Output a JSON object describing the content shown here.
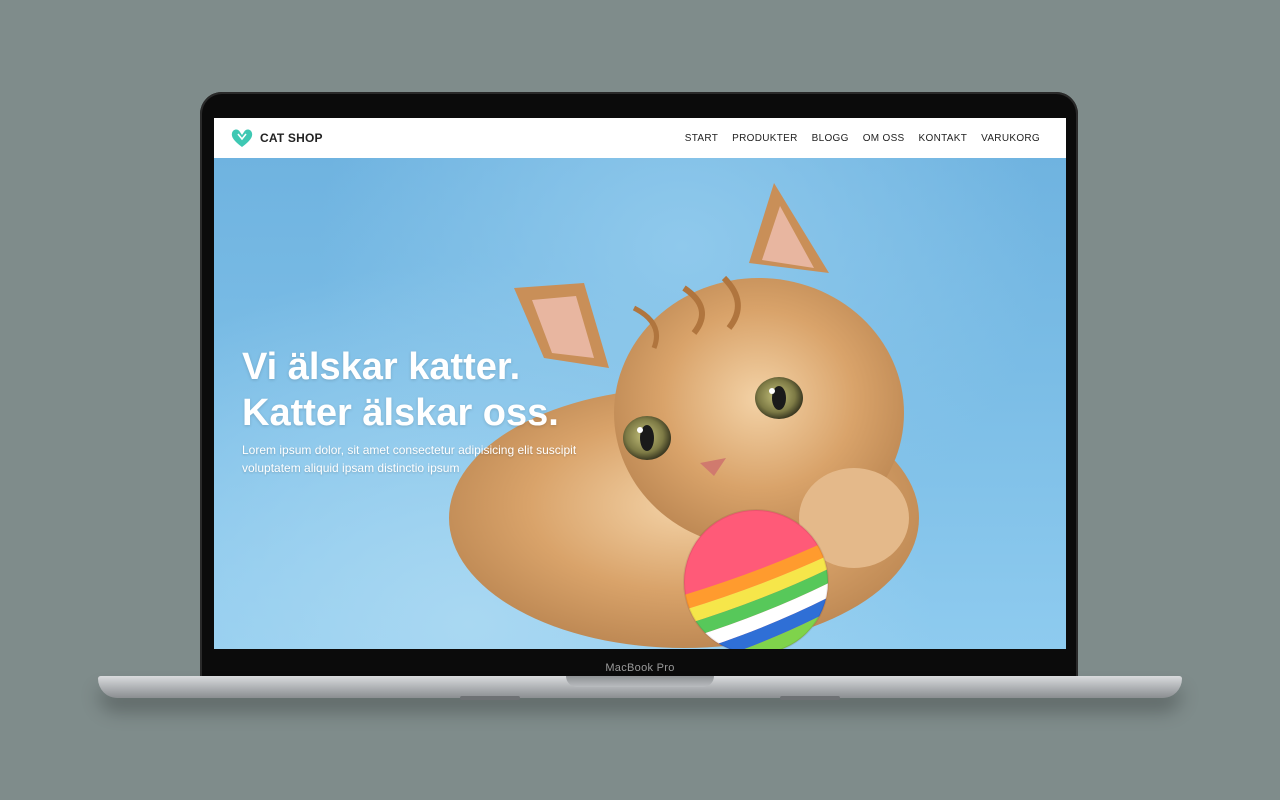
{
  "site": {
    "brand": "CAT SHOP",
    "nav": [
      "START",
      "PRODUKTER",
      "BLOGG",
      "OM OSS",
      "KONTAKT",
      "VARUKORG"
    ]
  },
  "hero": {
    "title_line1": "Vi älskar katter.",
    "title_line2": "Katter älskar oss.",
    "body_line1": "Lorem ipsum dolor, sit amet consectetur adipisicing elit suscipit",
    "body_line2": "voluptatem aliquid ipsam distinctio ipsum"
  },
  "device": {
    "label": "MacBook Pro"
  },
  "colors": {
    "brand_accent": "#3ec8b3",
    "background": "#7f8c8b",
    "hero_sky": "#7bbde6"
  },
  "icons": {
    "brand": "heart-logo-icon"
  }
}
